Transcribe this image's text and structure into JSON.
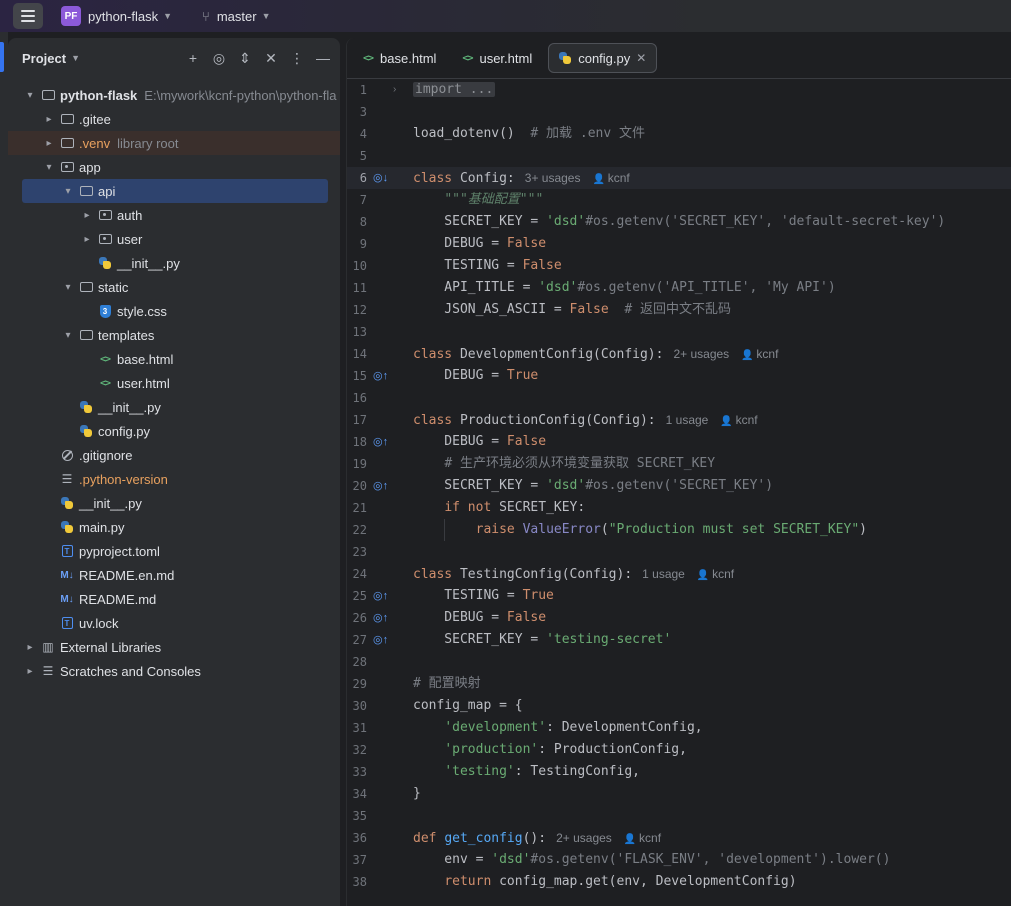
{
  "titlebar": {
    "project_badge": "PF",
    "project_name": "python-flask",
    "branch": "master"
  },
  "panel": {
    "title": "Project"
  },
  "tree": [
    {
      "label": "python-flask",
      "extra": "E:\\mywork\\kcnf-python\\python-fla",
      "indent": 0,
      "arrow": "▾",
      "icon": "folder",
      "bold": true
    },
    {
      "label": ".gitee",
      "indent": 1,
      "arrow": "▸",
      "icon": "folder"
    },
    {
      "label": ".venv",
      "extra": "library root",
      "indent": 1,
      "arrow": "▸",
      "icon": "folder",
      "color": "#e8a15f",
      "venv": true
    },
    {
      "label": "app",
      "indent": 1,
      "arrow": "▾",
      "icon": "folder-pkg"
    },
    {
      "label": "api",
      "indent": 2,
      "arrow": "▾",
      "icon": "folder",
      "selected": true
    },
    {
      "label": "auth",
      "indent": 3,
      "arrow": "▸",
      "icon": "folder-pkg"
    },
    {
      "label": "user",
      "indent": 3,
      "arrow": "▸",
      "icon": "folder-pkg"
    },
    {
      "label": "__init__.py",
      "indent": 3,
      "icon": "py"
    },
    {
      "label": "static",
      "indent": 2,
      "arrow": "▾",
      "icon": "folder"
    },
    {
      "label": "style.css",
      "indent": 3,
      "icon": "css"
    },
    {
      "label": "templates",
      "indent": 2,
      "arrow": "▾",
      "icon": "folder"
    },
    {
      "label": "base.html",
      "indent": 3,
      "icon": "html"
    },
    {
      "label": "user.html",
      "indent": 3,
      "icon": "html"
    },
    {
      "label": "__init__.py",
      "indent": 2,
      "icon": "py"
    },
    {
      "label": "config.py",
      "indent": 2,
      "icon": "py"
    },
    {
      "label": ".gitignore",
      "indent": 1,
      "icon": "git"
    },
    {
      "label": ".python-version",
      "indent": 1,
      "icon": "lines",
      "color": "#e8a15f"
    },
    {
      "label": "__init__.py",
      "indent": 1,
      "icon": "py"
    },
    {
      "label": "main.py",
      "indent": 1,
      "icon": "py"
    },
    {
      "label": "pyproject.toml",
      "indent": 1,
      "icon": "toml"
    },
    {
      "label": "README.en.md",
      "indent": 1,
      "icon": "md"
    },
    {
      "label": "README.md",
      "indent": 1,
      "icon": "md"
    },
    {
      "label": "uv.lock",
      "indent": 1,
      "icon": "toml"
    },
    {
      "label": "External Libraries",
      "indent": 0,
      "arrow": "▸",
      "icon": "lib"
    },
    {
      "label": "Scratches and Consoles",
      "indent": 0,
      "arrow": "▸",
      "icon": "lines"
    }
  ],
  "tabs": [
    {
      "label": "base.html",
      "icon": "html",
      "active": false
    },
    {
      "label": "user.html",
      "icon": "html",
      "active": false
    },
    {
      "label": "config.py",
      "icon": "py",
      "active": true
    }
  ],
  "code": [
    {
      "n": "1",
      "fold": "›",
      "t": [
        [
          "folded",
          "import ..."
        ]
      ]
    },
    {
      "n": "3",
      "t": []
    },
    {
      "n": "4",
      "t": [
        [
          "",
          "load_dotenv()  "
        ],
        [
          "cm",
          "# 加载 .env 文件"
        ]
      ]
    },
    {
      "n": "5",
      "t": []
    },
    {
      "n": "6",
      "gut": "◎↓",
      "hl": true,
      "t": [
        [
          "kw",
          "class "
        ],
        [
          "",
          "Config:"
        ]
      ],
      "hint": "3+ usages",
      "author": "kcnf"
    },
    {
      "n": "7",
      "t": [
        [
          "",
          "    "
        ],
        [
          "doc",
          "\"\"\"基础配置\"\"\""
        ]
      ]
    },
    {
      "n": "8",
      "t": [
        [
          "",
          "    SECRET_KEY = "
        ],
        [
          "str",
          "'dsd'"
        ],
        [
          "cm",
          "#os.getenv('SECRET_KEY', 'default-secret-key')"
        ]
      ]
    },
    {
      "n": "9",
      "t": [
        [
          "",
          "    DEBUG = "
        ],
        [
          "kw",
          "False"
        ]
      ]
    },
    {
      "n": "10",
      "t": [
        [
          "",
          "    TESTING = "
        ],
        [
          "kw",
          "False"
        ]
      ]
    },
    {
      "n": "11",
      "t": [
        [
          "",
          "    API_TITLE = "
        ],
        [
          "str",
          "'dsd'"
        ],
        [
          "cm",
          "#os.getenv('API_TITLE', 'My API')"
        ]
      ]
    },
    {
      "n": "12",
      "t": [
        [
          "",
          "    JSON_AS_ASCII = "
        ],
        [
          "kw",
          "False"
        ],
        [
          "",
          "  "
        ],
        [
          "cm",
          "# 返回中文不乱码"
        ]
      ]
    },
    {
      "n": "13",
      "t": []
    },
    {
      "n": "14",
      "t": [
        [
          "kw",
          "class "
        ],
        [
          "",
          "DevelopmentConfig(Config):"
        ]
      ],
      "hint": "2+ usages",
      "author": "kcnf"
    },
    {
      "n": "15",
      "gut": "◎↑",
      "t": [
        [
          "",
          "    DEBUG = "
        ],
        [
          "kw",
          "True"
        ]
      ]
    },
    {
      "n": "16",
      "t": []
    },
    {
      "n": "17",
      "t": [
        [
          "kw",
          "class "
        ],
        [
          "",
          "ProductionConfig(Config):"
        ]
      ],
      "hint": "1 usage",
      "author": "kcnf"
    },
    {
      "n": "18",
      "gut": "◎↑",
      "t": [
        [
          "",
          "    DEBUG = "
        ],
        [
          "kw",
          "False"
        ]
      ]
    },
    {
      "n": "19",
      "t": [
        [
          "",
          "    "
        ],
        [
          "cm",
          "# 生产环境必须从环境变量获取 SECRET_KEY"
        ]
      ]
    },
    {
      "n": "20",
      "gut": "◎↑",
      "t": [
        [
          "",
          "    SECRET_KEY = "
        ],
        [
          "str",
          "'dsd'"
        ],
        [
          "cm",
          "#os.getenv('SECRET_KEY')"
        ]
      ]
    },
    {
      "n": "21",
      "t": [
        [
          "",
          "    "
        ],
        [
          "kw",
          "if not "
        ],
        [
          "",
          "SECRET_KEY:"
        ]
      ]
    },
    {
      "n": "22",
      "guide": true,
      "t": [
        [
          "",
          "        "
        ],
        [
          "kw",
          "raise "
        ],
        [
          "bi",
          "ValueError"
        ],
        [
          "",
          "("
        ],
        [
          "str",
          "\"Production must set SECRET_KEY\""
        ],
        [
          "",
          ")"
        ]
      ]
    },
    {
      "n": "23",
      "t": []
    },
    {
      "n": "24",
      "t": [
        [
          "kw",
          "class "
        ],
        [
          "",
          "TestingConfig(Config):"
        ]
      ],
      "hint": "1 usage",
      "author": "kcnf"
    },
    {
      "n": "25",
      "gut": "◎↑",
      "t": [
        [
          "",
          "    TESTING = "
        ],
        [
          "kw",
          "True"
        ]
      ]
    },
    {
      "n": "26",
      "gut": "◎↑",
      "t": [
        [
          "",
          "    DEBUG = "
        ],
        [
          "kw",
          "False"
        ]
      ]
    },
    {
      "n": "27",
      "gut": "◎↑",
      "t": [
        [
          "",
          "    SECRET_KEY = "
        ],
        [
          "str",
          "'testing-secret'"
        ]
      ]
    },
    {
      "n": "28",
      "t": []
    },
    {
      "n": "29",
      "t": [
        [
          "cm",
          "# 配置映射"
        ]
      ]
    },
    {
      "n": "30",
      "t": [
        [
          "",
          "config_map = {"
        ]
      ]
    },
    {
      "n": "31",
      "t": [
        [
          "",
          "    "
        ],
        [
          "str",
          "'development'"
        ],
        [
          "",
          ": DevelopmentConfig,"
        ]
      ]
    },
    {
      "n": "32",
      "t": [
        [
          "",
          "    "
        ],
        [
          "str",
          "'production'"
        ],
        [
          "",
          ": ProductionConfig,"
        ]
      ]
    },
    {
      "n": "33",
      "t": [
        [
          "",
          "    "
        ],
        [
          "str",
          "'testing'"
        ],
        [
          "",
          ": TestingConfig,"
        ]
      ]
    },
    {
      "n": "34",
      "t": [
        [
          "",
          "}"
        ]
      ]
    },
    {
      "n": "35",
      "t": []
    },
    {
      "n": "36",
      "t": [
        [
          "kw",
          "def "
        ],
        [
          "fn",
          "get_config"
        ],
        [
          "",
          "():"
        ]
      ],
      "hint": "2+ usages",
      "author": "kcnf"
    },
    {
      "n": "37",
      "t": [
        [
          "",
          "    env = "
        ],
        [
          "str",
          "'dsd'"
        ],
        [
          "cm",
          "#os.getenv('FLASK_ENV', 'development').lower()"
        ]
      ]
    },
    {
      "n": "38",
      "t": [
        [
          "",
          "    "
        ],
        [
          "kw",
          "return "
        ],
        [
          "",
          "config_map.get(env, DevelopmentConfig)"
        ]
      ]
    }
  ]
}
